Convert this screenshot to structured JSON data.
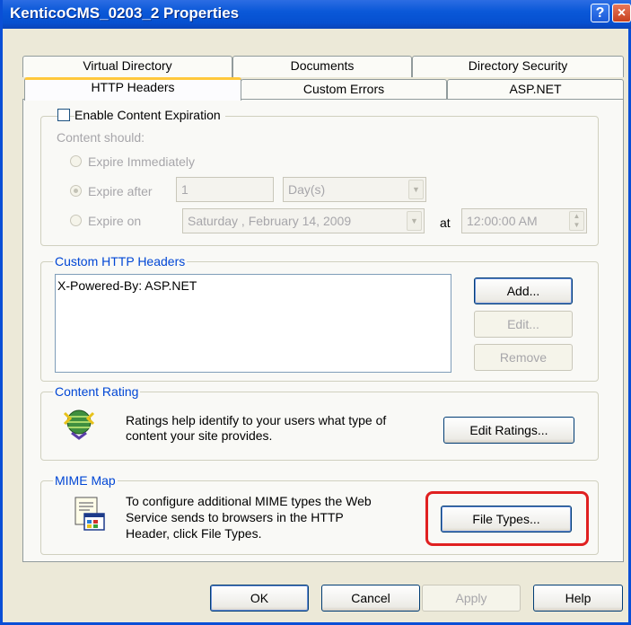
{
  "window": {
    "title": "KenticoCMS_0203_2 Properties",
    "help_label": "?",
    "close_label": "×"
  },
  "tabs": {
    "row_back": [
      "Virtual Directory",
      "Documents",
      "Directory Security"
    ],
    "row_front": [
      "HTTP Headers",
      "Custom Errors",
      "ASP.NET"
    ],
    "active": "HTTP Headers"
  },
  "expiration": {
    "checkbox_label": "Enable Content Expiration",
    "checked": false,
    "content_should": "Content should:",
    "expire_immediately": "Expire Immediately",
    "expire_after": "Expire after",
    "expire_after_value": "1",
    "expire_after_unit": "Day(s)",
    "expire_on": "Expire on",
    "expire_on_date": "Saturday  ,  February  14, 2009",
    "at_label": "at",
    "expire_on_time": "12:00:00 AM",
    "selected": "Expire after"
  },
  "custom_headers": {
    "legend": "Custom HTTP Headers",
    "items": [
      "X-Powered-By: ASP.NET"
    ],
    "add_label": "Add...",
    "edit_label": "Edit...",
    "remove_label": "Remove"
  },
  "content_rating": {
    "legend": "Content Rating",
    "description_line1": "Ratings help identify to your users what type of",
    "description_line2": "content your site provides.",
    "edit_ratings_label": "Edit Ratings..."
  },
  "mime_map": {
    "legend": "MIME Map",
    "description_line1": "To configure additional MIME types the Web",
    "description_line2": "Service sends to browsers in the HTTP",
    "description_line3": "Header, click File Types.",
    "file_types_label": "File Types..."
  },
  "footer": {
    "ok_label": "OK",
    "cancel_label": "Cancel",
    "apply_label": "Apply",
    "help_label": "Help"
  },
  "colors": {
    "title_bar": "#0a58d8",
    "highlight": "#e02020",
    "group_legend": "#0046d5"
  }
}
